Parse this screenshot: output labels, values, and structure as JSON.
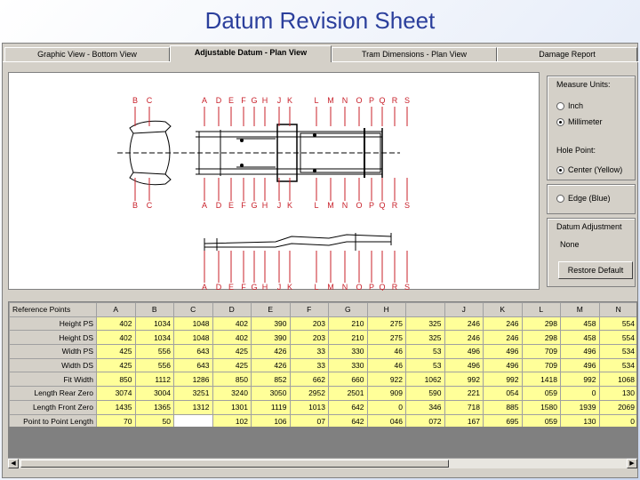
{
  "slide": {
    "title": "Datum Revision Sheet"
  },
  "tabs": [
    {
      "label": "Graphic View - Bottom View",
      "active": false
    },
    {
      "label": "Adjustable Datum - Plan View",
      "active": true
    },
    {
      "label": "Tram Dimensions - Plan View",
      "active": false
    },
    {
      "label": "Damage Report",
      "active": false
    }
  ],
  "diagram": {
    "top_letters": [
      "B",
      "C",
      "A",
      "D",
      "E",
      "F",
      "G",
      "H",
      "J",
      "K",
      "L",
      "M",
      "N",
      "O",
      "P",
      "Q",
      "R",
      "S"
    ],
    "bottom_letters": [
      "B",
      "C",
      "A",
      "D",
      "E",
      "F",
      "G",
      "H",
      "J",
      "K",
      "L",
      "M",
      "N",
      "O",
      "P",
      "Q",
      "R",
      "S"
    ],
    "side_letters": [
      "A",
      "D",
      "E",
      "F",
      "G",
      "H",
      "J",
      "K",
      "L",
      "M",
      "N",
      "O",
      "P",
      "Q",
      "R",
      "S"
    ]
  },
  "panel": {
    "measure_units": {
      "title": "Measure Units:",
      "options": [
        "Inch",
        "Millimeter"
      ],
      "selected": "Millimeter"
    },
    "hole_point": {
      "title": "Hole Point:",
      "options": [
        "Center (Yellow)",
        "Edge (Blue)"
      ],
      "selected": "Center (Yellow)"
    },
    "datum_adjustment": {
      "title": "Datum Adjustment",
      "value": "None"
    },
    "restore_button": "Restore Default"
  },
  "table": {
    "corner": "Reference Points",
    "columns": [
      "A",
      "B",
      "C",
      "D",
      "E",
      "F",
      "G",
      "H",
      "",
      "J",
      "K",
      "L",
      "M",
      "N"
    ],
    "rows": [
      {
        "label": "Height PS",
        "values": [
          "402",
          "1034",
          "1048",
          "402",
          "390",
          "203",
          "210",
          "275",
          "325",
          "246",
          "246",
          "298",
          "458",
          "554"
        ]
      },
      {
        "label": "Height DS",
        "values": [
          "402",
          "1034",
          "1048",
          "402",
          "390",
          "203",
          "210",
          "275",
          "325",
          "246",
          "246",
          "298",
          "458",
          "554"
        ]
      },
      {
        "label": "Width PS",
        "values": [
          "425",
          "556",
          "643",
          "425",
          "426",
          "33",
          "330",
          "46",
          "53",
          "496",
          "496",
          "709",
          "496",
          "534"
        ]
      },
      {
        "label": "Width DS",
        "values": [
          "425",
          "556",
          "643",
          "425",
          "426",
          "33",
          "330",
          "46",
          "53",
          "496",
          "496",
          "709",
          "496",
          "534"
        ]
      },
      {
        "label": "Fit Width",
        "values": [
          "850",
          "1112",
          "1286",
          "850",
          "852",
          "662",
          "660",
          "922",
          "1062",
          "992",
          "992",
          "1418",
          "992",
          "1068"
        ]
      },
      {
        "label": "Length Rear Zero",
        "values": [
          "3074",
          "3004",
          "3251",
          "3240",
          "3050",
          "2952",
          "2501",
          "909",
          "590",
          "221",
          "054",
          "059",
          "0",
          "130"
        ]
      },
      {
        "label": "Length Front Zero",
        "values": [
          "1435",
          "1365",
          "1312",
          "1301",
          "1119",
          "1013",
          "642",
          "0",
          "346",
          "718",
          "885",
          "1580",
          "1939",
          "2069"
        ]
      },
      {
        "label": "Point to Point Length",
        "values": [
          "70",
          "50",
          "",
          "102",
          "106",
          "07",
          "642",
          "046",
          "072",
          "167",
          "695",
          "059",
          "130",
          "0"
        ]
      }
    ]
  },
  "colors": {
    "title": "#2b3f9c",
    "window": "#d4d0c8",
    "cell": "#ffff99",
    "marker": "#c8202a"
  }
}
